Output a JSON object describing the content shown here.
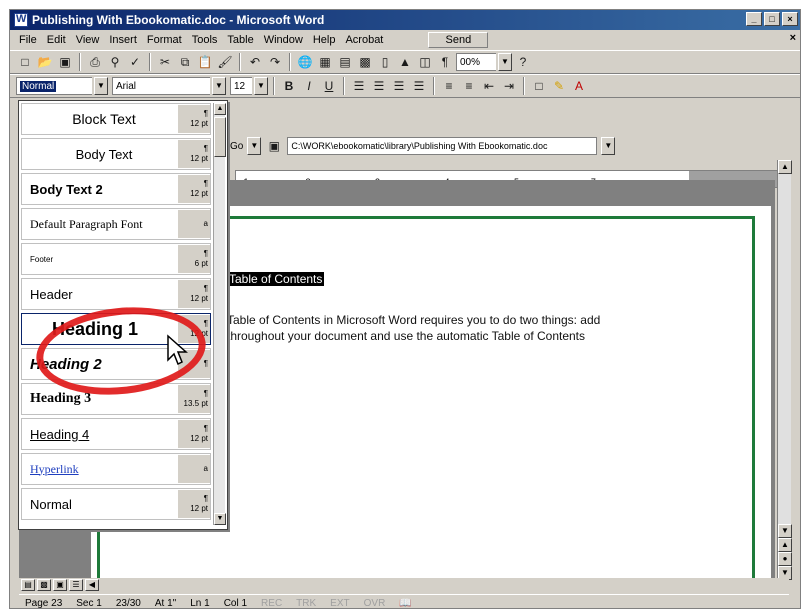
{
  "window": {
    "title": "Publishing With Ebookomatic.doc - Microsoft Word",
    "controls": {
      "minimize": "_",
      "maximize": "□",
      "close": "×"
    }
  },
  "menubar": {
    "items": [
      "File",
      "Edit",
      "View",
      "Insert",
      "Format",
      "Tools",
      "Table",
      "Window",
      "Help",
      "Acrobat"
    ],
    "send_label": "Send",
    "close_label": "×"
  },
  "formatting": {
    "style_value": "Normal",
    "font_value": "Arial",
    "size_value": "12",
    "bold_label": "B",
    "italic_label": "I",
    "underline_label": "U",
    "zoom_value": "00%"
  },
  "web_toolbar": {
    "go_label": "Go",
    "path_value": "C:\\WORK\\ebookomatic\\library\\Publishing With Ebookomatic.doc"
  },
  "ruler": {
    "ticks": "· 1 · · · · · · · 2 · · · · · · · · 3 · · · · · · · · 4 · · · · · · · · 5 · · · · · · · · · 7"
  },
  "document": {
    "heading": "Table of Contents",
    "line1": "Table of Contents in Microsoft Word requires you to do two things: add",
    "line2": "throughout your document and use the automatic Table of Contents"
  },
  "style_list": {
    "items": [
      {
        "label": "Block Text",
        "meta1": "¶",
        "meta2": "12 pt"
      },
      {
        "label": "Body Text",
        "meta1": "¶",
        "meta2": "12 pt"
      },
      {
        "label": "Body Text 2",
        "meta1": "¶",
        "meta2": "12 pt"
      },
      {
        "label": "Default Paragraph Font",
        "meta1": "a",
        "meta2": ""
      },
      {
        "label": "Footer",
        "meta1": "¶",
        "meta2": "6 pt"
      },
      {
        "label": "Header",
        "meta1": "¶",
        "meta2": "12 pt"
      },
      {
        "label": "Heading 1",
        "meta1": "¶",
        "meta2": "12 pt"
      },
      {
        "label": "Heading 2",
        "meta1": "¶",
        "meta2": ""
      },
      {
        "label": "Heading 3",
        "meta1": "¶",
        "meta2": "13.5 pt"
      },
      {
        "label": "Heading 4",
        "meta1": "¶",
        "meta2": "12 pt"
      },
      {
        "label": "Hyperlink",
        "meta1": "a",
        "meta2": ""
      },
      {
        "label": "Normal",
        "meta1": "¶",
        "meta2": "12 pt"
      }
    ]
  },
  "statusbar": {
    "page": "Page 23",
    "sec": "Sec 1",
    "pos": "23/30",
    "at": "At 1\"",
    "ln": "Ln 1",
    "col": "Col 1",
    "rec": "REC",
    "trk": "TRK",
    "ext": "EXT",
    "ovr": "OVR"
  },
  "colors": {
    "title_bar": "#0a246a",
    "highlight": "#e01a1a",
    "margin_guides": "#1e7a3a"
  },
  "icons": [
    "new-icon",
    "open-icon",
    "save-icon",
    "print-icon",
    "preview-icon",
    "spelling-icon",
    "cut-icon",
    "copy-icon",
    "paste-icon",
    "undo-icon",
    "redo-icon",
    "help-icon"
  ]
}
